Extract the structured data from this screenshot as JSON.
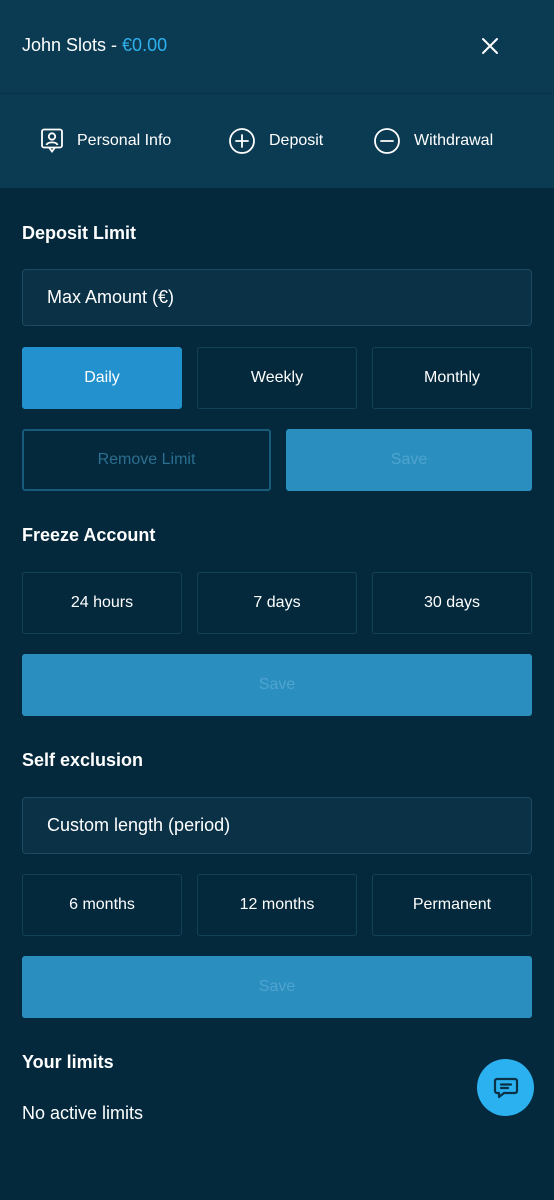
{
  "header": {
    "user_name": "John Slots - ",
    "balance": "€0.00",
    "close_icon": "close-icon"
  },
  "nav": {
    "items": [
      {
        "label": "Personal Info",
        "icon": "profile-icon"
      },
      {
        "label": "Deposit",
        "icon": "plus-circle-icon"
      },
      {
        "label": "Withdrawal",
        "icon": "minus-circle-icon"
      }
    ]
  },
  "deposit_limit": {
    "title": "Deposit Limit",
    "amount_placeholder": "Max Amount (€)",
    "periods": [
      "Daily",
      "Weekly",
      "Monthly"
    ],
    "selected_period": "Daily",
    "remove_label": "Remove Limit",
    "save_label": "Save"
  },
  "freeze_account": {
    "title": "Freeze Account",
    "options": [
      "24 hours",
      "7 days",
      "30 days"
    ],
    "save_label": "Save"
  },
  "self_exclusion": {
    "title": "Self exclusion",
    "custom_label": "Custom length (period)",
    "options": [
      "6 months",
      "12 months",
      "Permanent"
    ],
    "save_label": "Save"
  },
  "your_limits": {
    "title": "Your limits",
    "status": "No active limits"
  },
  "chat": {
    "icon": "chat-icon"
  },
  "colors": {
    "background": "#04293c",
    "header": "#0b3b52",
    "accent": "#2fb1ee",
    "active": "#2291cd",
    "save": "#2a8ebf"
  }
}
